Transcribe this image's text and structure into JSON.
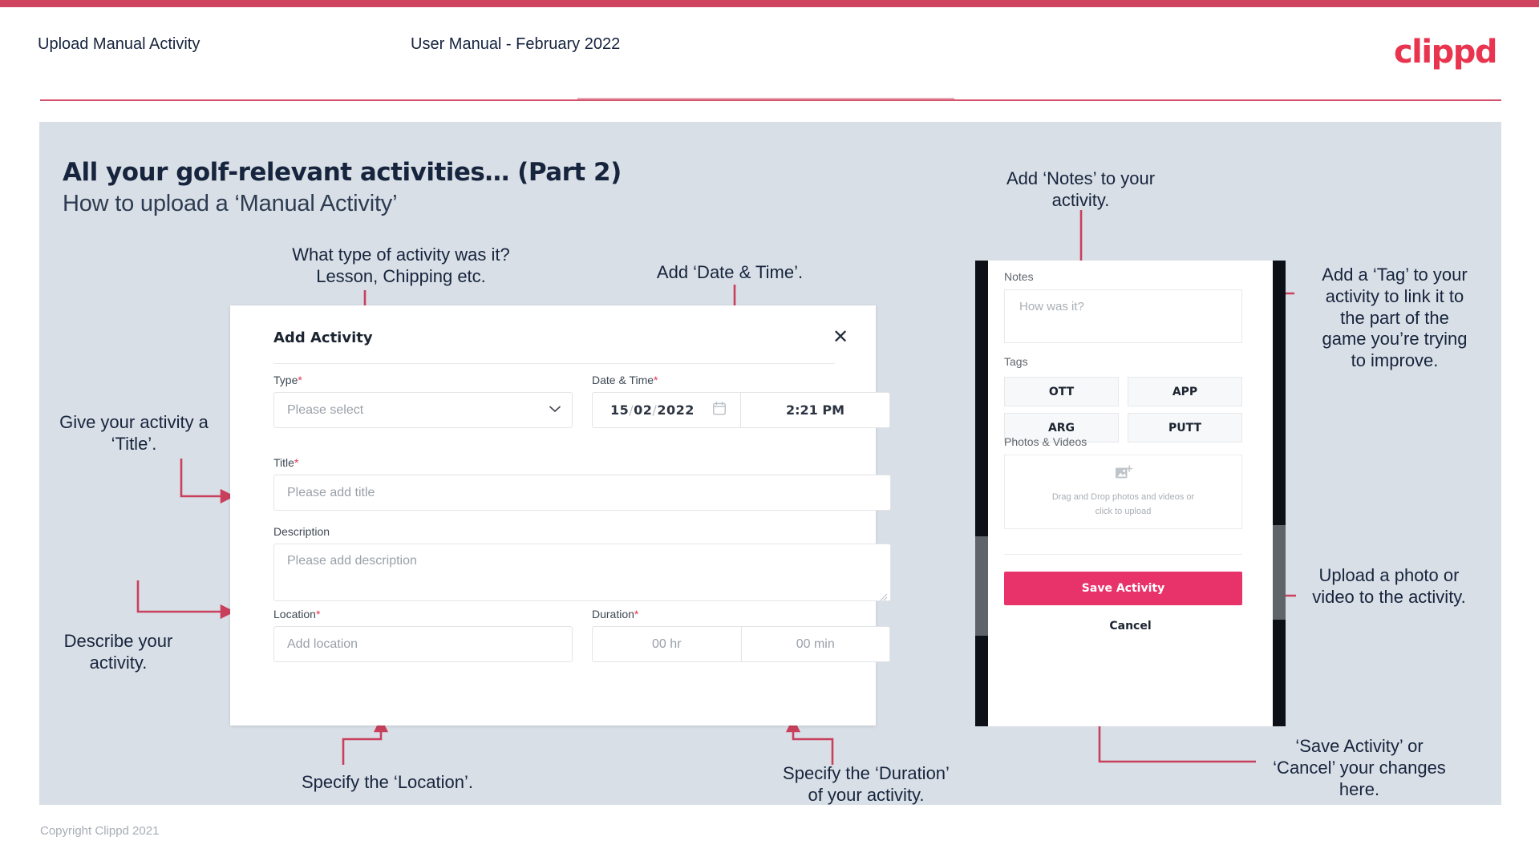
{
  "header": {
    "left_title": "Upload Manual Activity",
    "center_title": "User Manual - February 2022",
    "logo": "clippd"
  },
  "slide": {
    "title": "All your golf-relevant activities… (Part 2)",
    "subtitle": "How to upload a ‘Manual Activity’",
    "copyright": "Copyright Clippd 2021"
  },
  "dialog": {
    "title": "Add Activity",
    "close_icon": "close-icon",
    "fields": {
      "type": {
        "label": "Type",
        "required": "*",
        "placeholder": "Please select",
        "chevron_icon": "chevron-down-icon"
      },
      "datetime": {
        "label": "Date & Time",
        "required": "*",
        "day": "15",
        "month": "02",
        "year": "2022",
        "sep": "/",
        "calendar_icon": "calendar-icon",
        "time": "2:21 PM"
      },
      "title": {
        "label": "Title",
        "required": "*",
        "placeholder": "Please add title"
      },
      "description": {
        "label": "Description",
        "required": "",
        "placeholder": "Please add description"
      },
      "location": {
        "label": "Location",
        "required": "*",
        "placeholder": "Add location"
      },
      "duration": {
        "label": "Duration",
        "required": "*",
        "hours": "00 hr",
        "minutes": "00 min"
      }
    }
  },
  "phone": {
    "notes": {
      "label": "Notes",
      "placeholder": "How was it?"
    },
    "tags": {
      "label": "Tags",
      "items": [
        "OTT",
        "APP",
        "ARG",
        "PUTT"
      ]
    },
    "photos": {
      "label": "Photos & Videos",
      "icon": "add-image-icon",
      "drop_line1": "Drag and Drop photos and videos or",
      "drop_line2": "click to upload"
    },
    "save_label": "Save Activity",
    "cancel_label": "Cancel"
  },
  "annotations": {
    "type": "What type of activity was it?\nLesson, Chipping etc.",
    "datetime": "Add ‘Date & Time’.",
    "notes": "Add ‘Notes’ to your\nactivity.",
    "tag": "Add a ‘Tag’ to your\nactivity to link it to\nthe part of the\ngame you’re trying\nto improve.",
    "title": "Give your activity a\n‘Title’.",
    "description": "Describe your\nactivity.",
    "location": "Specify the ‘Location’.",
    "duration": "Specify the ‘Duration’\nof your activity.",
    "upload": "Upload a photo or\nvideo to the activity.",
    "save": "‘Save Activity’ or\n‘Cancel’ your changes\nhere."
  },
  "colors": {
    "brand_pink": "#e8344e",
    "save_pink": "#e8336a",
    "arrow_red": "#c9405c",
    "slide_bg": "#d9dfe6",
    "ink": "#16243d"
  }
}
